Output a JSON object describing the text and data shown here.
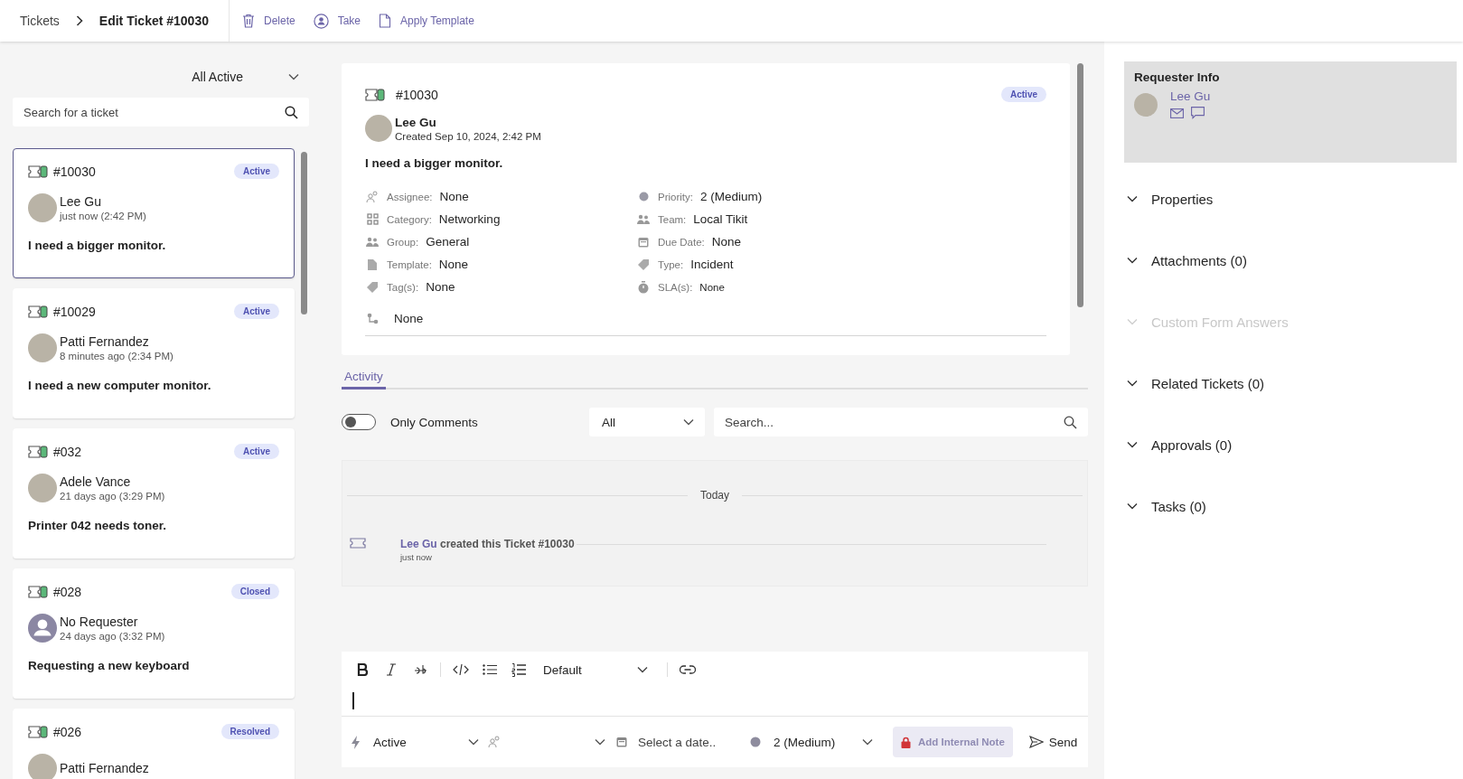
{
  "header": {
    "breadcrumb": [
      "Tickets",
      "Edit Ticket #10030"
    ],
    "actions": [
      {
        "kind": "delete",
        "label": "Delete"
      },
      {
        "kind": "take",
        "label": "Take"
      },
      {
        "kind": "template",
        "label": "Apply Template"
      }
    ]
  },
  "ticket_list": {
    "filter": "All Active",
    "search": {
      "placeholder": "Search for a ticket"
    },
    "tickets": [
      {
        "number": "#10030",
        "status": "Active",
        "requester": "Lee Gu",
        "photo": true,
        "time": "just now (2:42 PM)",
        "title": "I need a bigger monitor.",
        "selected": true
      },
      {
        "number": "#10029",
        "status": "Active",
        "requester": "Patti Fernandez",
        "photo": true,
        "time": "8 minutes ago (2:34 PM)",
        "title": "I need a new computer monitor.",
        "selected": false
      },
      {
        "number": "#032",
        "status": "Active",
        "requester": "Adele Vance",
        "photo": true,
        "time": "21 days ago (3:29 PM)",
        "title": "Printer 042 needs toner.",
        "selected": false
      },
      {
        "number": "#028",
        "status": "Closed",
        "requester": "No Requester",
        "photo": false,
        "time": "24 days ago (3:32 PM)",
        "title": "Requesting a new keyboard",
        "selected": false
      },
      {
        "number": "#026",
        "status": "Resolved",
        "requester": "Patti Fernandez",
        "photo": true,
        "selected": false
      }
    ]
  },
  "ticket": {
    "number": "#10030",
    "status": "Active",
    "requester": "Lee Gu",
    "created": "Created Sep 10, 2024, 2:42 PM",
    "title": "I need a bigger monitor.",
    "fields_left": [
      {
        "kind": "assignee",
        "label": "Assignee:",
        "value": "None"
      },
      {
        "kind": "category",
        "label": "Category:",
        "value": "Networking"
      },
      {
        "kind": "group",
        "label": "Group:",
        "value": "General"
      },
      {
        "kind": "template",
        "label": "Template:",
        "value": "None"
      },
      {
        "kind": "tags",
        "label": "Tag(s):",
        "value": "None"
      }
    ],
    "fields_right": [
      {
        "kind": "priority",
        "label": "Priority:",
        "value": "2 (Medium)"
      },
      {
        "kind": "team",
        "label": "Team:",
        "value": "Local Tikit"
      },
      {
        "kind": "due",
        "label": "Due Date:",
        "value": "None"
      },
      {
        "kind": "type",
        "label": "Type:",
        "value": "Incident"
      },
      {
        "kind": "sla",
        "label": "SLA(s):",
        "value": "None"
      }
    ],
    "workflow": "None"
  },
  "activity": {
    "tabs": [
      {
        "label": "Activity",
        "selected": true
      }
    ],
    "only_comments": {
      "label": "Only Comments",
      "on": false
    },
    "filter": "All",
    "search": {
      "placeholder": "Search..."
    },
    "day": "Today",
    "entries": [
      {
        "author": "Lee Gu",
        "text": "created this Ticket #10030",
        "time": "just now"
      }
    ]
  },
  "editor": {
    "style": "Default",
    "status": "Active",
    "date": {
      "placeholder": "Select a date.."
    },
    "priority": "2 (Medium)",
    "note_button": {
      "label": "Add Internal Note",
      "disabled": true
    },
    "send": "Send"
  },
  "requester_info": {
    "title": "Requester Info",
    "name": "Lee Gu"
  },
  "sections": [
    {
      "label": "Properties",
      "disabled": false
    },
    {
      "label": "Attachments (0)",
      "disabled": false
    },
    {
      "label": "Custom Form Answers",
      "disabled": true
    },
    {
      "label": "Related Tickets (0)",
      "disabled": false
    },
    {
      "label": "Approvals (0)",
      "disabled": false
    },
    {
      "label": "Tasks (0)",
      "disabled": false
    }
  ]
}
